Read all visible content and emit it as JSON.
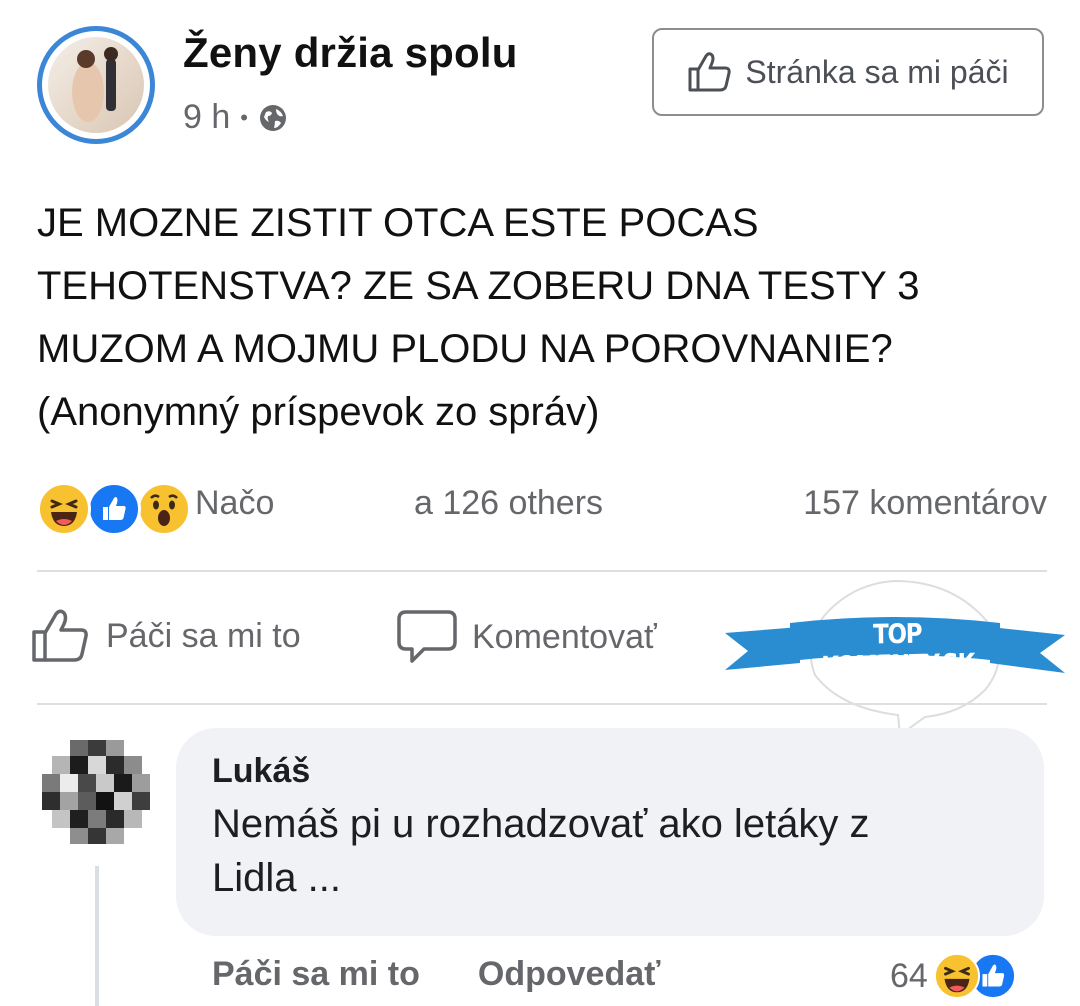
{
  "post": {
    "page_name": "Ženy držia spolu",
    "time": "9 h",
    "meta_separator": "•",
    "like_page_label": "Stránka sa mi páči",
    "text_lines": [
      "JE MOZNE ZISTIT OTCA ESTE POCAS",
      "TEHOTENSTVA? ZE SA ZOBERU DNA TESTY 3",
      "MUZOM A MOJMU PLODU NA POROVNANIE?",
      "(Anonymný príspevok zo správ)"
    ]
  },
  "reactions": {
    "icons": [
      "laugh-reaction-icon",
      "like-reaction-icon",
      "wow-reaction-icon"
    ],
    "name": "Načo",
    "others": "a 126 others",
    "comments_count": "157 komentárov"
  },
  "actions": {
    "like_label": "Páči sa mi to",
    "comment_label": "Komentovať"
  },
  "watermark": {
    "text": "TOP KOMENTY.SK"
  },
  "comment": {
    "author": "Lukáš",
    "text_lines": [
      "Nemáš pi u rozhadzovať ako letáky z",
      "Lidla ..."
    ],
    "like_label": "Páči sa mi to",
    "reply_label": "Odpovedať",
    "reaction_count": "64",
    "reaction_icons": [
      "laugh-reaction-icon",
      "like-reaction-icon"
    ]
  },
  "colors": {
    "accent_blue": "#3b86d6",
    "watermark_blue": "#2a8dd2",
    "muted_text": "#65676b",
    "bubble_bg": "#f0f2f5"
  }
}
